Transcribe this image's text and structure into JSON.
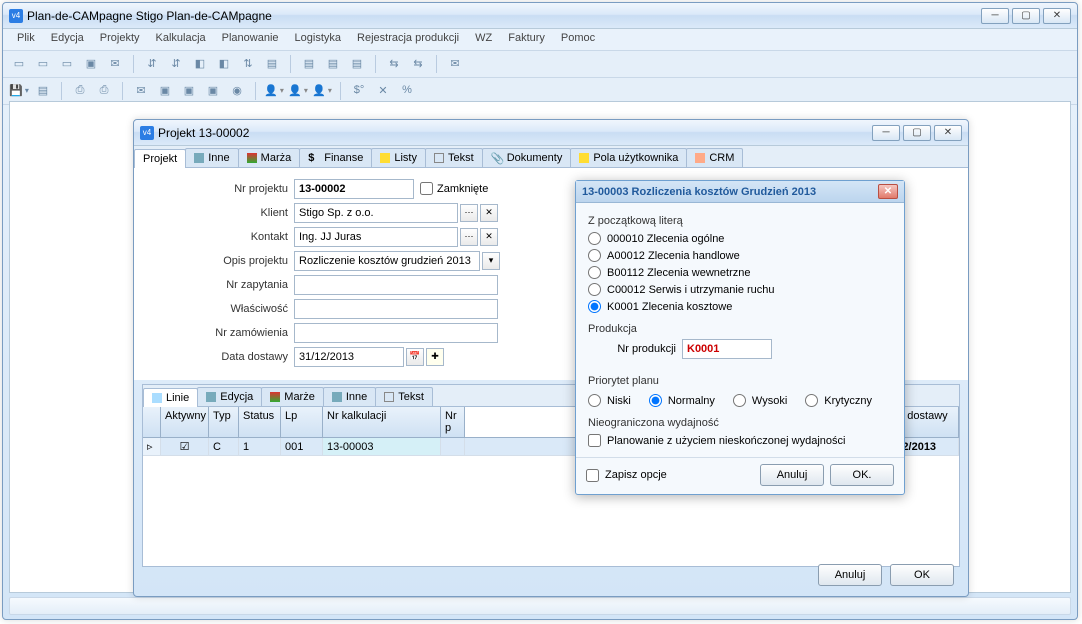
{
  "mainWindow": {
    "title": "Plan-de-CAMpagne  Stigo Plan-de-CAMpagne",
    "menus": [
      "Plik",
      "Edycja",
      "Projekty",
      "Kalkulacja",
      "Planowanie",
      "Logistyka",
      "Rejestracja produkcji",
      "WZ",
      "Faktury",
      "Pomoc"
    ]
  },
  "projectWindow": {
    "title": "Projekt 13-00002",
    "tabs": [
      "Projekt",
      "Inne",
      "Marża",
      "Finanse",
      "Listy",
      "Tekst",
      "Dokumenty",
      "Pola użytkownika",
      "CRM"
    ],
    "form": {
      "labels": {
        "nrProjektu": "Nr projektu",
        "klient": "Klient",
        "kontakt": "Kontakt",
        "opis": "Opis projektu",
        "nrZapytania": "Nr zapytania",
        "wlasciwosc": "Właściwość",
        "nrZamowienia": "Nr zamówienia",
        "dataDostawy": "Data dostawy"
      },
      "values": {
        "nrProjektu": "13-00002",
        "zamkniete": "Zamknięte",
        "klient": "Stigo Sp. z o.o.",
        "kontakt": "Ing. JJ Juras",
        "opis": "Rozliczenie kosztów grudzień 2013",
        "nrZapytania": "",
        "wlasciwosc": "",
        "nrZamowienia": "",
        "dataDostawy": "31/12/2013"
      }
    },
    "gridTabs": [
      "Linie",
      "Edycja",
      "Marże",
      "Inne",
      "Tekst"
    ],
    "gridHeaders": [
      "",
      "Aktywny",
      "Typ",
      "Status",
      "Lp",
      "Nr kalkulacji",
      "Nr p",
      "Data dostawy"
    ],
    "gridRow": {
      "aktywny": "☑",
      "typ": "C",
      "status": "1",
      "lp": "001",
      "nrKalkulacji": "13-00003",
      "dataDostawy": "31/12/2013"
    },
    "buttons": {
      "anuluj": "Anuluj",
      "ok": "OK"
    }
  },
  "dialog": {
    "title": "13-00003 Rozliczenia kosztów Grudzień 2013",
    "section1Label": "Z początkową literą",
    "radios": [
      "000010 Zlecenia ogólne",
      "A00012 Zlecenia handlowe",
      "B00112 Zlecenia wewnetrzne",
      "C00012 Serwis i utrzymanie ruchu",
      "K0001 Zlecenia kosztowe"
    ],
    "selectedRadio": 4,
    "produkcjaLabel": "Produkcja",
    "nrProdukcjiLabel": "Nr produkcji",
    "nrProdukcjiValue": "K0001",
    "priorytetLabel": "Priorytet planu",
    "priorytety": [
      "Niski",
      "Normalny",
      "Wysoki",
      "Krytyczny"
    ],
    "selectedPriorytet": 1,
    "wydajnoscLabel": "Nieograniczona wydajność",
    "wydajnoscCheckbox": "Planowanie z użyciem nieskończonej wydajności",
    "zapiszOpcje": "Zapisz opcje",
    "buttons": {
      "anuluj": "Anuluj",
      "ok": "OK."
    }
  }
}
